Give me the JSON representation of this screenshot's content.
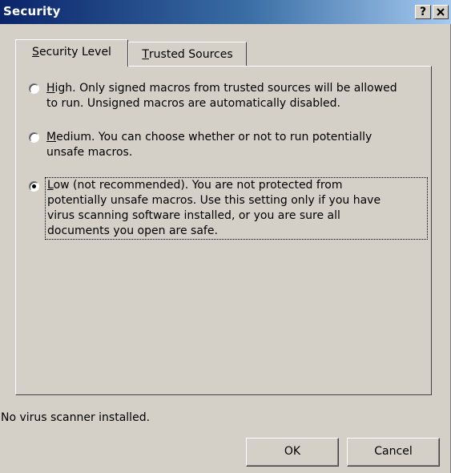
{
  "window": {
    "title": "Security",
    "help_label": "?"
  },
  "tabs": [
    {
      "label": "Security Level",
      "accel": "S",
      "rest": "ecurity Level",
      "selected": true
    },
    {
      "label": "Trusted Sources",
      "accel": "T",
      "rest": "rusted Sources",
      "selected": false
    }
  ],
  "options": [
    {
      "id": "high",
      "accel": "H",
      "rest": "igh. Only signed macros from trusted sources will be allowed\nto run. Unsigned macros are automatically disabled.",
      "checked": false
    },
    {
      "id": "medium",
      "accel": "M",
      "rest": "edium. You can choose whether or not to run potentially\nunsafe macros.",
      "checked": false
    },
    {
      "id": "low",
      "accel": "L",
      "rest": "ow (not recommended). You are not protected from\npotentially unsafe macros. Use this setting only if you have\nvirus scanning software installed, or you are sure all\ndocuments you open are safe.",
      "checked": true
    }
  ],
  "status": {
    "text": "No virus scanner installed."
  },
  "buttons": {
    "ok_label": "OK",
    "cancel_label": "Cancel"
  },
  "colors": {
    "face": "#d4d0c8",
    "title_start": "#0a246a",
    "title_end": "#a6caf0"
  }
}
